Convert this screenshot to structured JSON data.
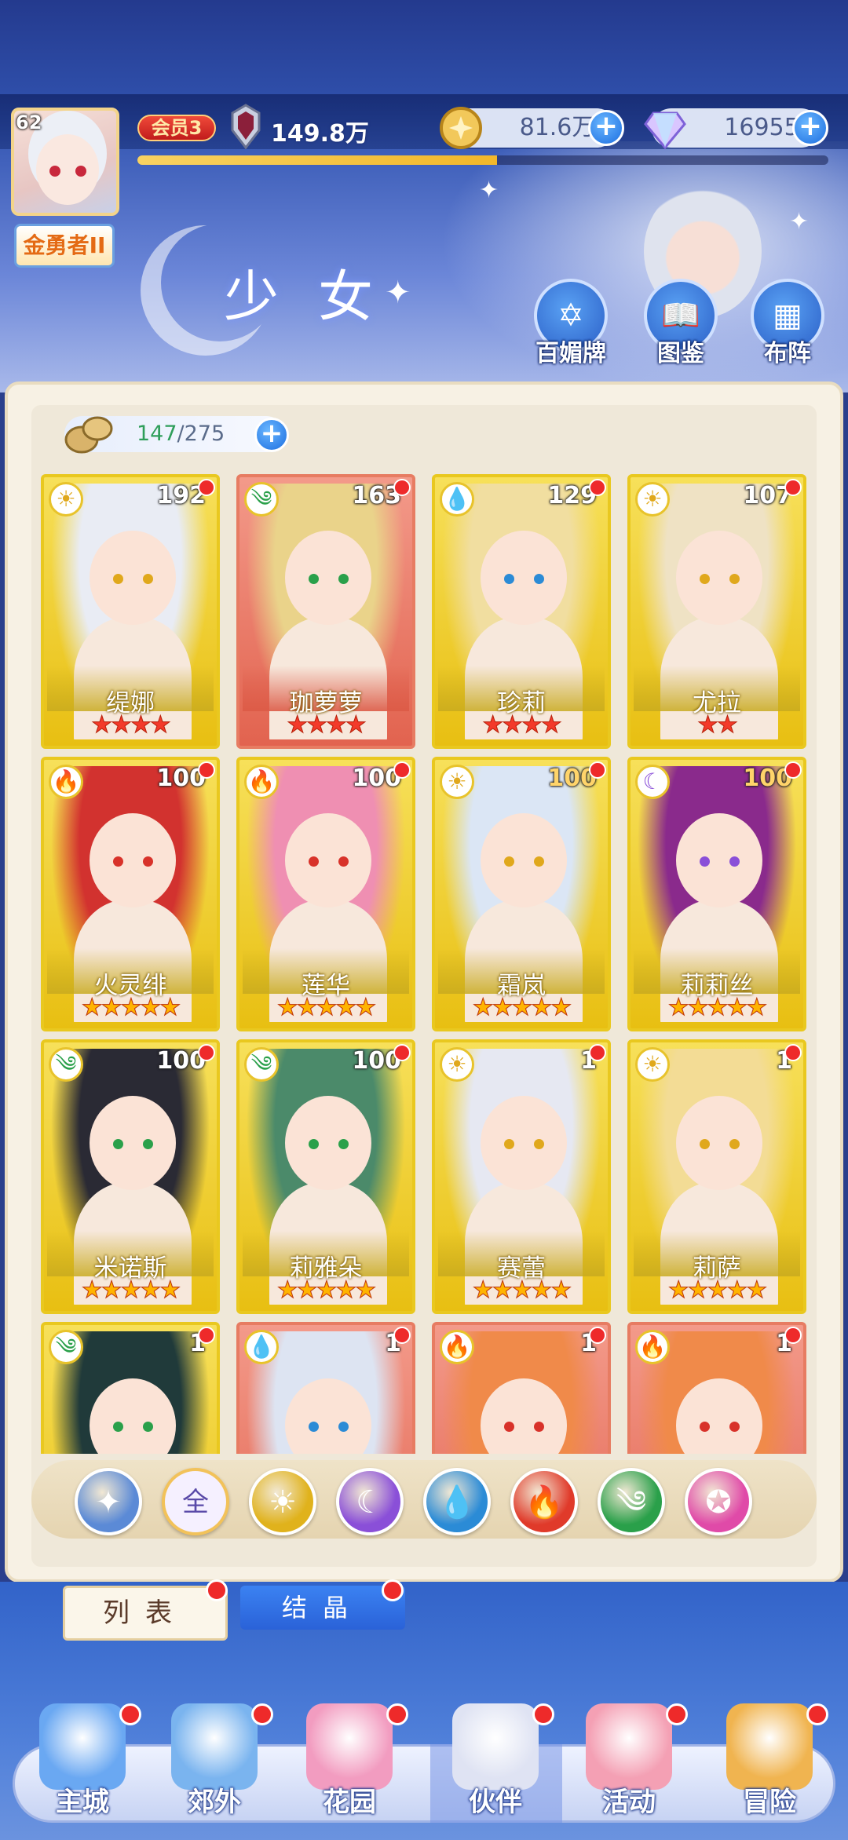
{
  "player": {
    "level": "62",
    "title": "金勇者II",
    "vip": "会员3",
    "power": "149.8万",
    "gold": "81.6万",
    "crystal": "16955",
    "exp_fraction": 0.52
  },
  "page": {
    "title": "少女",
    "quick_buttons": [
      {
        "label": "百媚牌",
        "icon": "star-badge-icon"
      },
      {
        "label": "图鉴",
        "icon": "book-icon"
      },
      {
        "label": "布阵",
        "icon": "grid-icon"
      }
    ]
  },
  "capacity": {
    "current": "147",
    "max": "/275"
  },
  "cards": [
    {
      "name": "缇娜",
      "level": "192",
      "element": "light",
      "stars": "★★★★",
      "frame": "gold",
      "hair": "#e9ecf4"
    },
    {
      "name": "珈萝萝",
      "level": "163",
      "element": "wind",
      "stars": "★★★★",
      "frame": "red",
      "hair": "#ead38a"
    },
    {
      "name": "珍莉",
      "level": "129",
      "element": "water",
      "stars": "★★★★",
      "frame": "gold",
      "hair": "#f1dea0"
    },
    {
      "name": "尤拉",
      "level": "107",
      "element": "light",
      "stars": "★★",
      "frame": "gold",
      "hair": "#efe2c4"
    },
    {
      "name": "火灵绯",
      "level": "100",
      "element": "fire",
      "stars": "★★★★★",
      "frame": "gold",
      "hair": "#d2322f"
    },
    {
      "name": "莲华",
      "level": "100",
      "element": "fire",
      "stars": "★★★★★",
      "frame": "gold",
      "hair": "#ef8fb2"
    },
    {
      "name": "霜岚",
      "level": "100",
      "element": "light",
      "stars": "★★★★★",
      "frame": "gold",
      "hair": "#dbe6f5"
    },
    {
      "name": "莉莉丝",
      "level": "100",
      "element": "dark",
      "stars": "★★★★★",
      "frame": "gold",
      "hair": "#8a2a8c"
    },
    {
      "name": "米诺斯",
      "level": "100",
      "element": "wind",
      "stars": "★★★★★",
      "frame": "gold",
      "hair": "#2a2a34"
    },
    {
      "name": "莉雅朵",
      "level": "100",
      "element": "wind",
      "stars": "★★★★★",
      "frame": "gold",
      "hair": "#4b8a6a"
    },
    {
      "name": "赛蕾",
      "level": "1",
      "element": "light",
      "stars": "★★★★★",
      "frame": "gold",
      "hair": "#e6e8f2"
    },
    {
      "name": "莉萨",
      "level": "1",
      "element": "light",
      "stars": "★★★★★",
      "frame": "gold",
      "hair": "#f3dc95"
    },
    {
      "name": "",
      "level": "1",
      "element": "wind",
      "stars": "",
      "frame": "gold",
      "hair": "#203a3a"
    },
    {
      "name": "",
      "level": "1",
      "element": "water",
      "stars": "",
      "frame": "red",
      "hair": "#dde4f2"
    },
    {
      "name": "",
      "level": "1",
      "element": "fire",
      "stars": "",
      "frame": "red",
      "hair": "#f08a4a"
    },
    {
      "name": "",
      "level": "1",
      "element": "fire",
      "stars": "",
      "frame": "red",
      "hair": "#f08a4a"
    }
  ],
  "filters": [
    {
      "id": "special",
      "glyph": "✦",
      "color": "#5b8ad6"
    },
    {
      "id": "all",
      "glyph": "全",
      "color": "#f5f0ff"
    },
    {
      "id": "light",
      "glyph": "☀",
      "color": "#e0b21c"
    },
    {
      "id": "dark",
      "glyph": "☾",
      "color": "#8a4fd8"
    },
    {
      "id": "water",
      "glyph": "💧",
      "color": "#2b8bd6"
    },
    {
      "id": "fire",
      "glyph": "🔥",
      "color": "#e03a2a"
    },
    {
      "id": "wind",
      "glyph": "༄",
      "color": "#2aa04a"
    },
    {
      "id": "star",
      "glyph": "✪",
      "color": "#e04aa8"
    }
  ],
  "tabs": {
    "list": "列表",
    "crystal": "结晶"
  },
  "nav": [
    {
      "label": "主城",
      "color": "#6aa8f2"
    },
    {
      "label": "郊外",
      "color": "#7ab4ef"
    },
    {
      "label": "花园",
      "color": "#f29cc0"
    },
    {
      "label": "伙伴",
      "color": "#dfe3f3"
    },
    {
      "label": "活动",
      "color": "#f4a0b4"
    },
    {
      "label": "冒险",
      "color": "#f0b450"
    }
  ]
}
